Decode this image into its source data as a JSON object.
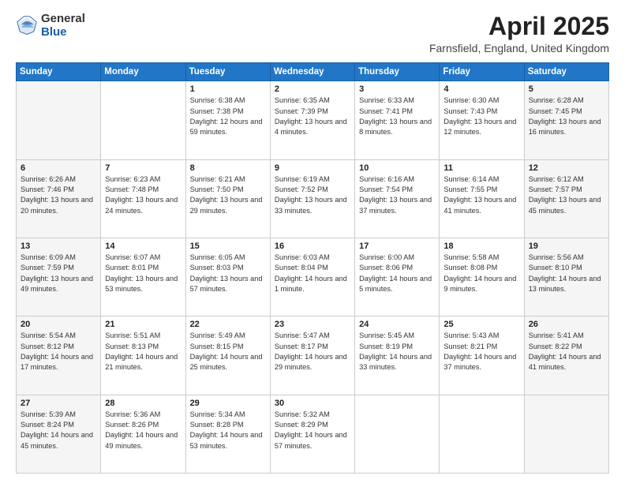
{
  "header": {
    "logo_general": "General",
    "logo_blue": "Blue",
    "title": "April 2025",
    "subtitle": "Farnsfield, England, United Kingdom"
  },
  "days_of_week": [
    "Sunday",
    "Monday",
    "Tuesday",
    "Wednesday",
    "Thursday",
    "Friday",
    "Saturday"
  ],
  "weeks": [
    [
      {
        "day": "",
        "sunrise": "",
        "sunset": "",
        "daylight": ""
      },
      {
        "day": "",
        "sunrise": "",
        "sunset": "",
        "daylight": ""
      },
      {
        "day": "1",
        "sunrise": "Sunrise: 6:38 AM",
        "sunset": "Sunset: 7:38 PM",
        "daylight": "Daylight: 12 hours and 59 minutes."
      },
      {
        "day": "2",
        "sunrise": "Sunrise: 6:35 AM",
        "sunset": "Sunset: 7:39 PM",
        "daylight": "Daylight: 13 hours and 4 minutes."
      },
      {
        "day": "3",
        "sunrise": "Sunrise: 6:33 AM",
        "sunset": "Sunset: 7:41 PM",
        "daylight": "Daylight: 13 hours and 8 minutes."
      },
      {
        "day": "4",
        "sunrise": "Sunrise: 6:30 AM",
        "sunset": "Sunset: 7:43 PM",
        "daylight": "Daylight: 13 hours and 12 minutes."
      },
      {
        "day": "5",
        "sunrise": "Sunrise: 6:28 AM",
        "sunset": "Sunset: 7:45 PM",
        "daylight": "Daylight: 13 hours and 16 minutes."
      }
    ],
    [
      {
        "day": "6",
        "sunrise": "Sunrise: 6:26 AM",
        "sunset": "Sunset: 7:46 PM",
        "daylight": "Daylight: 13 hours and 20 minutes."
      },
      {
        "day": "7",
        "sunrise": "Sunrise: 6:23 AM",
        "sunset": "Sunset: 7:48 PM",
        "daylight": "Daylight: 13 hours and 24 minutes."
      },
      {
        "day": "8",
        "sunrise": "Sunrise: 6:21 AM",
        "sunset": "Sunset: 7:50 PM",
        "daylight": "Daylight: 13 hours and 29 minutes."
      },
      {
        "day": "9",
        "sunrise": "Sunrise: 6:19 AM",
        "sunset": "Sunset: 7:52 PM",
        "daylight": "Daylight: 13 hours and 33 minutes."
      },
      {
        "day": "10",
        "sunrise": "Sunrise: 6:16 AM",
        "sunset": "Sunset: 7:54 PM",
        "daylight": "Daylight: 13 hours and 37 minutes."
      },
      {
        "day": "11",
        "sunrise": "Sunrise: 6:14 AM",
        "sunset": "Sunset: 7:55 PM",
        "daylight": "Daylight: 13 hours and 41 minutes."
      },
      {
        "day": "12",
        "sunrise": "Sunrise: 6:12 AM",
        "sunset": "Sunset: 7:57 PM",
        "daylight": "Daylight: 13 hours and 45 minutes."
      }
    ],
    [
      {
        "day": "13",
        "sunrise": "Sunrise: 6:09 AM",
        "sunset": "Sunset: 7:59 PM",
        "daylight": "Daylight: 13 hours and 49 minutes."
      },
      {
        "day": "14",
        "sunrise": "Sunrise: 6:07 AM",
        "sunset": "Sunset: 8:01 PM",
        "daylight": "Daylight: 13 hours and 53 minutes."
      },
      {
        "day": "15",
        "sunrise": "Sunrise: 6:05 AM",
        "sunset": "Sunset: 8:03 PM",
        "daylight": "Daylight: 13 hours and 57 minutes."
      },
      {
        "day": "16",
        "sunrise": "Sunrise: 6:03 AM",
        "sunset": "Sunset: 8:04 PM",
        "daylight": "Daylight: 14 hours and 1 minute."
      },
      {
        "day": "17",
        "sunrise": "Sunrise: 6:00 AM",
        "sunset": "Sunset: 8:06 PM",
        "daylight": "Daylight: 14 hours and 5 minutes."
      },
      {
        "day": "18",
        "sunrise": "Sunrise: 5:58 AM",
        "sunset": "Sunset: 8:08 PM",
        "daylight": "Daylight: 14 hours and 9 minutes."
      },
      {
        "day": "19",
        "sunrise": "Sunrise: 5:56 AM",
        "sunset": "Sunset: 8:10 PM",
        "daylight": "Daylight: 14 hours and 13 minutes."
      }
    ],
    [
      {
        "day": "20",
        "sunrise": "Sunrise: 5:54 AM",
        "sunset": "Sunset: 8:12 PM",
        "daylight": "Daylight: 14 hours and 17 minutes."
      },
      {
        "day": "21",
        "sunrise": "Sunrise: 5:51 AM",
        "sunset": "Sunset: 8:13 PM",
        "daylight": "Daylight: 14 hours and 21 minutes."
      },
      {
        "day": "22",
        "sunrise": "Sunrise: 5:49 AM",
        "sunset": "Sunset: 8:15 PM",
        "daylight": "Daylight: 14 hours and 25 minutes."
      },
      {
        "day": "23",
        "sunrise": "Sunrise: 5:47 AM",
        "sunset": "Sunset: 8:17 PM",
        "daylight": "Daylight: 14 hours and 29 minutes."
      },
      {
        "day": "24",
        "sunrise": "Sunrise: 5:45 AM",
        "sunset": "Sunset: 8:19 PM",
        "daylight": "Daylight: 14 hours and 33 minutes."
      },
      {
        "day": "25",
        "sunrise": "Sunrise: 5:43 AM",
        "sunset": "Sunset: 8:21 PM",
        "daylight": "Daylight: 14 hours and 37 minutes."
      },
      {
        "day": "26",
        "sunrise": "Sunrise: 5:41 AM",
        "sunset": "Sunset: 8:22 PM",
        "daylight": "Daylight: 14 hours and 41 minutes."
      }
    ],
    [
      {
        "day": "27",
        "sunrise": "Sunrise: 5:39 AM",
        "sunset": "Sunset: 8:24 PM",
        "daylight": "Daylight: 14 hours and 45 minutes."
      },
      {
        "day": "28",
        "sunrise": "Sunrise: 5:36 AM",
        "sunset": "Sunset: 8:26 PM",
        "daylight": "Daylight: 14 hours and 49 minutes."
      },
      {
        "day": "29",
        "sunrise": "Sunrise: 5:34 AM",
        "sunset": "Sunset: 8:28 PM",
        "daylight": "Daylight: 14 hours and 53 minutes."
      },
      {
        "day": "30",
        "sunrise": "Sunrise: 5:32 AM",
        "sunset": "Sunset: 8:29 PM",
        "daylight": "Daylight: 14 hours and 57 minutes."
      },
      {
        "day": "",
        "sunrise": "",
        "sunset": "",
        "daylight": ""
      },
      {
        "day": "",
        "sunrise": "",
        "sunset": "",
        "daylight": ""
      },
      {
        "day": "",
        "sunrise": "",
        "sunset": "",
        "daylight": ""
      }
    ]
  ]
}
